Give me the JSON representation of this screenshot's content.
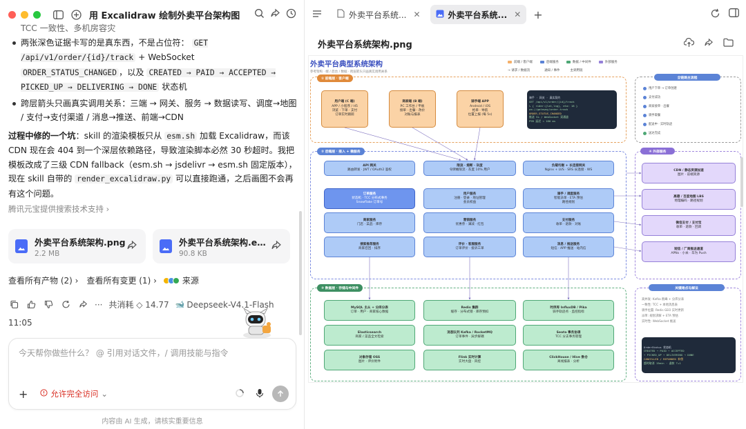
{
  "window": {
    "title": "用 Excalidraw 绘制外卖平台架构图",
    "traffic_colors": [
      "#ff5f57",
      "#febc2e",
      "#28c840"
    ]
  },
  "chat": {
    "cut_line": "TCC 一致性、多机房容灾",
    "bullet1_pre": "两张深色证据卡写的是真东西，不是占位符：",
    "bullet1_code1": "GET /api/v1/order/{id}/track",
    "bullet1_mid": " + WebSocket ",
    "bullet1_code2": "ORDER_STATUS_CHANGED",
    "bullet1_mid2": "，以及 ",
    "bullet1_code3": "CREATED → PAID → ACCEPTED → PICKED_UP → DELIVERING → DONE",
    "bullet1_post": " 状态机",
    "bullet2": "跨层箭头只画真实调用关系：三端 → 网关、服务 → 数据读写、调度→地图 / 支付→支付渠道 / 消息→推送、前端→CDN",
    "para_bold": "过程中修的一个坑",
    "para_a": "：skill 的渲染模板只从 ",
    "para_code1": "esm.sh",
    "para_b": " 加载 Excalidraw，而该 CDN 现在会 404 到一个深层依赖路径，导致渲染脚本必然 30 秒超时。我把模板改成了三级 CDN fallback（esm.sh → jsdelivr → esm.sh 固定版本），现在 skill 自带的 ",
    "para_code2": "render_excalidraw.py",
    "para_c": " 可以直接跑通，之后画图不会再有这个问题。",
    "source": "腾讯元宝提供搜索技术支持 ›"
  },
  "files": [
    {
      "name": "外卖平台系统架构.png",
      "size": "2.2 MB"
    },
    {
      "name": "外卖平台系统架构.ex...",
      "size": "90.8 KB"
    }
  ],
  "links": {
    "products": "查看所有产物 (2) ›",
    "changes": "查看所有变更 (1) ›",
    "source": "来源"
  },
  "actions": {
    "cost": "共消耗 ◇ 14.77",
    "model": "Deepseek-V4.1-Flash"
  },
  "time": "11:05",
  "composer": {
    "placeholder": "今天帮你做些什么？ @ 引用对话文件，/ 调用技能与指令",
    "permission": "允许完全访问"
  },
  "footer": "内容由 AI 生成，请核实重要信息",
  "tabs": [
    {
      "label": "外卖平台系统...",
      "active": false
    },
    {
      "label": "外卖平台系统...",
      "active": true
    }
  ],
  "preview": {
    "filename": "外卖平台系统架构.png"
  },
  "diagram": {
    "title": "外卖平台典型系统架构",
    "subtitle": "参考架构 · 端 / 后台 / 数据 · 跨层箭头只画真实调用关系",
    "legend": [
      {
        "label": "前端 / 客户端",
        "color": "#f5b06a"
      },
      {
        "label": "后端服务",
        "color": "#5b83d6"
      },
      {
        "label": "数据 / 中间件",
        "color": "#4ea775"
      },
      {
        "label": "外部服务",
        "color": "#9580d8"
      }
    ],
    "legend2": [
      "→ 请求 / 数据流",
      "通知 / 事件",
      "主调用链"
    ],
    "region1": "① 前端层 · 客户端",
    "region2": "② 后端层 · 接入 + 微服务",
    "region3": "③ 数据层 · 存储与中间件",
    "region4": "④ 外部服务",
    "clients": [
      {
        "title": "用户端 (C 端)",
        "lines": [
          "APP / 小程序 / H5",
          "浏览 · 下单 · 支付",
          "订单实时跟踪"
        ]
      },
      {
        "title": "商家端 (B 端)",
        "lines": [
          "PC 工作台 / 平板",
          "接单 · 出餐 · 改价",
          "对账与报表"
        ]
      },
      {
        "title": "骑手端 APP",
        "lines": [
          "Android / iOS",
          "抢单 · 导航",
          "位置上报 (每 5s)"
        ]
      }
    ],
    "evidence1": [
      "骑手 · 网关 · 真实契约",
      "GET /api/v1/order/{id}/track",
      "↳ { rider:{lat,lng}, eta: 18 }",
      "ws://gateway/order-track",
      "ORDER_STATUS_CHANGED",
      "推送 5s / WebSocket 双通道",
      "P99 延迟 < 180 ms"
    ],
    "gateway": [
      {
        "title": "API 网关",
        "lines": [
          "路由转发 · JWT / OAuth2 鉴权"
        ]
      },
      {
        "title": "限流 · 熔断 · 灰度",
        "lines": [
          "令牌桶限流 · 灰度 10% 用户"
        ]
      },
      {
        "title": "负载均衡 + 长连接网关",
        "lines": [
          "Nginx + LVS · SRS 长连接 · WS"
        ]
      }
    ],
    "services": [
      {
        "title": "订单服务",
        "lines": [
          "状态机 · TCC 分布式事务",
          "Snowflake 订单号"
        ],
        "dark": true
      },
      {
        "title": "用户服务",
        "lines": [
          "注册 · 登录 · 地址管理",
          "会员权益"
        ]
      },
      {
        "title": "骑手 / 调度服务",
        "lines": [
          "智能派单 · ETA 预估",
          "路径规划"
        ]
      },
      {
        "title": "商家服务",
        "lines": [
          "门店 · 菜品 · 库存"
        ]
      },
      {
        "title": "营销服务",
        "lines": [
          "优惠券 · 满减 · 红包"
        ]
      },
      {
        "title": "支付服务",
        "lines": [
          "收单 · 退款 · 对账"
        ]
      },
      {
        "title": "搜索推荐服务",
        "lines": [
          "商家召回 · 排序"
        ]
      },
      {
        "title": "评价 · 客服服务",
        "lines": [
          "订单评价 · 投诉工单"
        ]
      },
      {
        "title": "消息 / 推送服务",
        "lines": [
          "短信 · APP 推送 · 站内信"
        ]
      }
    ],
    "ext_title": "④ 外部服务",
    "externals": [
      {
        "title": "CDN / 静态资源加速",
        "lines": [
          "图片 · 前端资源"
        ]
      },
      {
        "title": "高德 / 百度地图 LBS",
        "lines": [
          "地理编码 · 路径规划"
        ]
      },
      {
        "title": "微信支付 / 支付宝",
        "lines": [
          "收单 · 退款 · 回调"
        ]
      },
      {
        "title": "短信 / 厂商推送通道",
        "lines": [
          "APNs · 小米 · 华为 Push"
        ]
      }
    ],
    "flow_title": "全链路主流程",
    "flow_steps": [
      "用户下单 → 订单创建",
      "支付成功",
      "商家接单 · 出餐",
      "骑手取餐",
      "配送中 · 实时轨迹",
      "送达完成"
    ],
    "data": [
      {
        "title": "MySQL 主从 + 分库分表",
        "lines": [
          "订单 · 用户 · 商家核心数据"
        ]
      },
      {
        "title": "Redis 集群",
        "lines": [
          "缓存 · 分布式锁 · 库存预扣"
        ]
      },
      {
        "title": "时序库 InfluxDB / Pika",
        "lines": [
          "骑手轨迹点 · 监控指标"
        ]
      },
      {
        "title": "Elasticsearch",
        "lines": [
          "商家 / 菜品全文检索"
        ]
      },
      {
        "title": "消息队列 Kafka / RocketMQ",
        "lines": [
          "订单事件 · 异步解耦"
        ]
      },
      {
        "title": "Seata 事务协调",
        "lines": [
          "TCC 分支事务管理"
        ]
      },
      {
        "title": "对象存储 OSS",
        "lines": [
          "图片 · 评价附件"
        ]
      },
      {
        "title": "Flink 实时计算",
        "lines": [
          "实时大盘 · 风控"
        ]
      },
      {
        "title": "ClickHouse / Hive 数仓",
        "lines": [
          "离线报表 · 分析"
        ]
      }
    ],
    "key_title": "关键难点与解法",
    "key_lines": [
      "高并发: Kafka 削峰 + 分库分表",
      "一致性: TCC + 本地消息表",
      "骑手位置: Redis GEO 实时更新",
      "派单: 规划求解 + ETA 预估",
      "实时性: WebSocket 推送"
    ],
    "evidence2": [
      "OrderStatus 状态机",
      "CREATED → PAID → ACCEPTED",
      "→ PICKED_UP → DELIVERING → DONE",
      "CANCELLED / REFUNDED 补偿",
      "超时取消 15min · 退款 T+1"
    ]
  }
}
